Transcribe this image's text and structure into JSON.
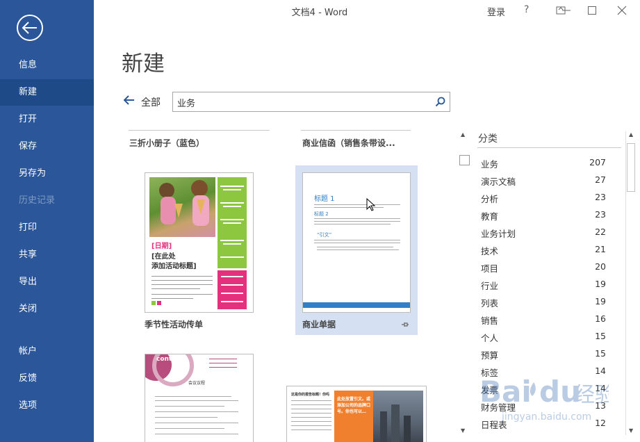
{
  "window": {
    "title": "文档4 - Word",
    "sign_in": "登录",
    "help": "?"
  },
  "sidebar": {
    "items": [
      {
        "label": "信息"
      },
      {
        "label": "新建"
      },
      {
        "label": "打开"
      },
      {
        "label": "保存"
      },
      {
        "label": "另存为"
      },
      {
        "label": "历史记录"
      },
      {
        "label": "打印"
      },
      {
        "label": "共享"
      },
      {
        "label": "导出"
      },
      {
        "label": "关闭"
      },
      {
        "label": "帐户"
      },
      {
        "label": "反馈"
      },
      {
        "label": "选项"
      }
    ]
  },
  "main": {
    "title": "新建",
    "breadcrumb_all": "全部",
    "search_value": "业务"
  },
  "templates": {
    "top_row": [
      {
        "title": "三折小册子（蓝色）"
      },
      {
        "title": "商业信函（销售条带设..."
      }
    ],
    "items": [
      {
        "title": "季节性活动传单",
        "date_text": "[日期]",
        "heading_text": "[在此处",
        "heading_text2": "添加活动标题]"
      },
      {
        "title": "商业单据",
        "heading": "标题 1",
        "sub": "标题 2",
        "quote": "“引文”"
      }
    ],
    "bottom_row": [
      {
        "logo": "contoso",
        "heading": "会议议程"
      },
      {
        "heading": "这是你的报告标题！你吗",
        "callout": "此处放置引文。或添加公司的品牌口号。你也可以… "
      }
    ]
  },
  "categories": {
    "header": "分类",
    "items": [
      {
        "name": "业务",
        "count": "207"
      },
      {
        "name": "演示文稿",
        "count": "27"
      },
      {
        "name": "分析",
        "count": "23"
      },
      {
        "name": "教育",
        "count": "23"
      },
      {
        "name": "业务计划",
        "count": "22"
      },
      {
        "name": "技术",
        "count": "21"
      },
      {
        "name": "项目",
        "count": "20"
      },
      {
        "name": "行业",
        "count": "19"
      },
      {
        "name": "列表",
        "count": "19"
      },
      {
        "name": "销售",
        "count": "16"
      },
      {
        "name": "个人",
        "count": "15"
      },
      {
        "name": "预算",
        "count": "15"
      },
      {
        "name": "标签",
        "count": "14"
      },
      {
        "name": "发票",
        "count": "14"
      },
      {
        "name": "财务管理",
        "count": "13"
      },
      {
        "name": "日程表",
        "count": "12"
      }
    ]
  },
  "colors": {
    "sidebar": "#2b579a",
    "sidebar_active": "#1e4a87",
    "flyer_green": "#8dc63f",
    "flyer_pink": "#e5307e",
    "doc_blue": "#2f80c9",
    "selection": "#d5e1f2"
  },
  "icons": {
    "back": "back-circle-arrow-icon",
    "search": "magnifier-icon",
    "pin": "pin-icon"
  }
}
